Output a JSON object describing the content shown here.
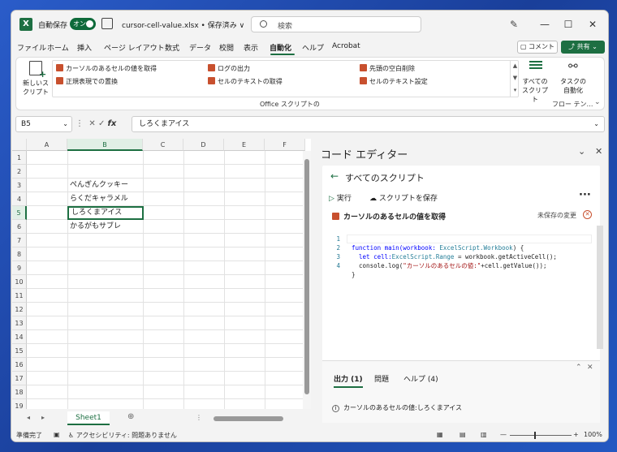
{
  "titlebar": {
    "logo": "X",
    "autosave_label": "自動保存",
    "autosave_state": "オン",
    "filename": "cursor-cell-value.xlsx • 保存済み ∨",
    "search_placeholder": "検索",
    "minimize": "—",
    "maximize": "☐",
    "close": "✕"
  },
  "menu": {
    "items": [
      "ファイル",
      "ホーム",
      "挿入",
      "ページ レイアウト",
      "数式",
      "データ",
      "校閲",
      "表示",
      "自動化",
      "ヘルプ",
      "Acrobat"
    ],
    "active": "自動化",
    "comment_label": "コメント",
    "share_label": "共有"
  },
  "ribbon": {
    "new_script_label_1": "新しいス",
    "new_script_label_2": "クリプト",
    "scripts": [
      "カーソルのあるセルの値を取得",
      "正規表現での置換",
      "ログの出力",
      "セルのテキストの取得",
      "先頭の空白削除",
      "セルのテキスト設定"
    ],
    "all_scripts_label_1": "すべての",
    "all_scripts_label_2": "スクリプト",
    "task_label_1": "タスクの",
    "task_label_2": "自動化",
    "group_label": "Office スクリプトの",
    "flow_label": "フロー テン…"
  },
  "formula": {
    "name_box": "B5",
    "value": "しろくまアイス"
  },
  "sheet": {
    "columns": [
      "A",
      "B",
      "C",
      "D",
      "E",
      "F"
    ],
    "selected_col": "B",
    "rows": [
      "1",
      "2",
      "3",
      "4",
      "5",
      "6",
      "7",
      "8",
      "9",
      "10",
      "11",
      "12",
      "13",
      "14",
      "15",
      "16",
      "17",
      "18",
      "19"
    ],
    "selected_row": "5",
    "cells": {
      "B3": "ぺんぎんクッキー",
      "B4": "らくだキャラメル",
      "B5": "しろくまアイス",
      "B6": "かるがもサブレ"
    },
    "tab_name": "Sheet1"
  },
  "status": {
    "ready": "準備完了",
    "accessibility": "アクセシビリティ: 問題ありません",
    "zoom": "100%"
  },
  "editor": {
    "title": "コード エディター",
    "nav_title": "すべてのスクリプト",
    "run_label": "実行",
    "save_label": "スクリプトを保存",
    "script_name": "カーソルのあるセルの値を取得",
    "unsaved_label": "未保存の変更",
    "code": {
      "l1_a": "function main(workbook: ",
      "l1_b": "ExcelScript.Workbook",
      "l1_c": ") {",
      "l2_a": "  let cell:",
      "l2_b": "ExcelScript.Range",
      "l2_c": " = workbook.getActiveCell();",
      "l3_a": "  console.log(",
      "l3_b": "\"カーソルのあるセルの値:\"",
      "l3_c": "+cell.getValue());",
      "l4": "}"
    },
    "output_tabs": [
      "出力 (1)",
      "問題",
      "ヘルプ (4)"
    ],
    "output_message": "カーソルのあるセルの値:しろくまアイス"
  }
}
